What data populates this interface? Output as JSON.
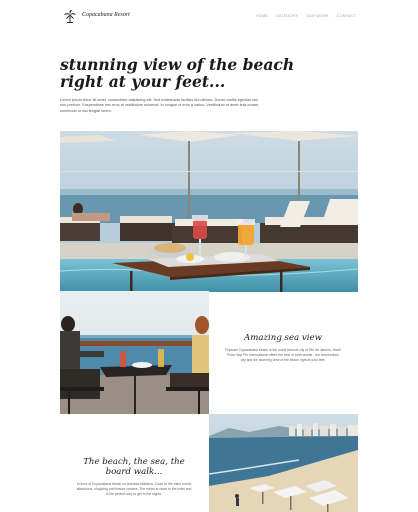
{
  "header": {
    "brand": "Copacabana Resort",
    "logo_icon": "palm-tree-icon",
    "nav": [
      "HOME",
      "CATEGORY",
      "OUR WORK",
      "CONTACT"
    ]
  },
  "hero": {
    "title_line1": "stunning view of the beach",
    "title_line2": "right at your feet...",
    "body": "Lorem ipsum dolor sit amet, consectetur adipiscing elit. Sed malesuada facilisis dui ultrices. Donec mattis egestas nisl non pretium. Suspendisse nec eros at vestibulum euismod. In congue ut eros a varius. Vestibulum et amet felis ornare, commodo ut nisi feugiat lorem."
  },
  "features": [
    {
      "title": "Amazing sea view",
      "text": "Popham Copacabana beach is the world famous city of Rio de Janeiro, Hotel Porto Sep Pre International offers the best of both worlds - the tremendous city and the stunning view of the beach right at your feet."
    },
    {
      "title_line1": "The beach, the sea, the",
      "title_line2": "board walk...",
      "text": "In front of Copacabana beach on Avenida Atlântica. Close to the main tourist attractions, shopping and leisure centers. The metro is close to the hotel and is the perfect way to get to the sights."
    }
  ],
  "colors": {
    "sky": "#b9d0df",
    "sea": "#5d8fa8",
    "pool": "#6fb9cf",
    "table_wood": "#6b3a22",
    "text_dark": "#1a1a1a"
  }
}
